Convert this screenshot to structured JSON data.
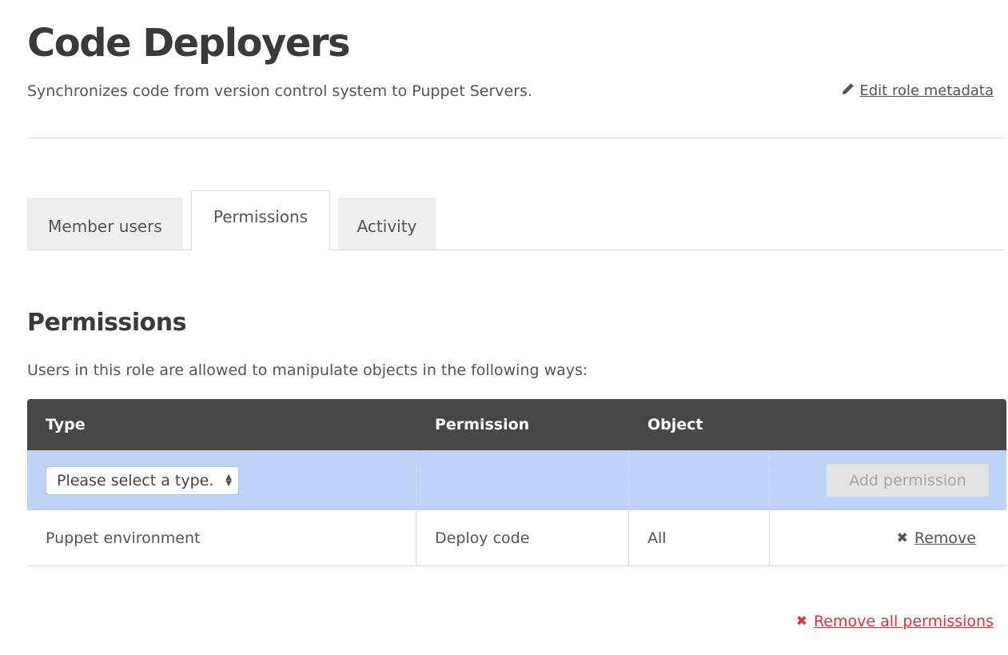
{
  "header": {
    "title": "Code Deployers",
    "description": "Synchronizes code from version control system to Puppet Servers.",
    "edit_link": "Edit role metadata",
    "edit_icon": "pencil-icon"
  },
  "tabs": [
    {
      "label": "Member users",
      "active": false
    },
    {
      "label": "Permissions",
      "active": true
    },
    {
      "label": "Activity",
      "active": false
    }
  ],
  "section": {
    "title": "Permissions",
    "description": "Users in this role are allowed to manipulate objects in the following ways:"
  },
  "table": {
    "headers": [
      "Type",
      "Permission",
      "Object",
      ""
    ],
    "add_row": {
      "type_select_value": "Please select a type.",
      "add_button": "Add permission"
    },
    "rows": [
      {
        "type": "Puppet environment",
        "permission": "Deploy code",
        "object": "All",
        "action": "Remove"
      }
    ]
  },
  "footer": {
    "remove_all": "Remove all permissions"
  },
  "colors": {
    "header_bg": "#474747",
    "add_row_bg": "#bdd3f7",
    "danger": "#d9333f"
  }
}
